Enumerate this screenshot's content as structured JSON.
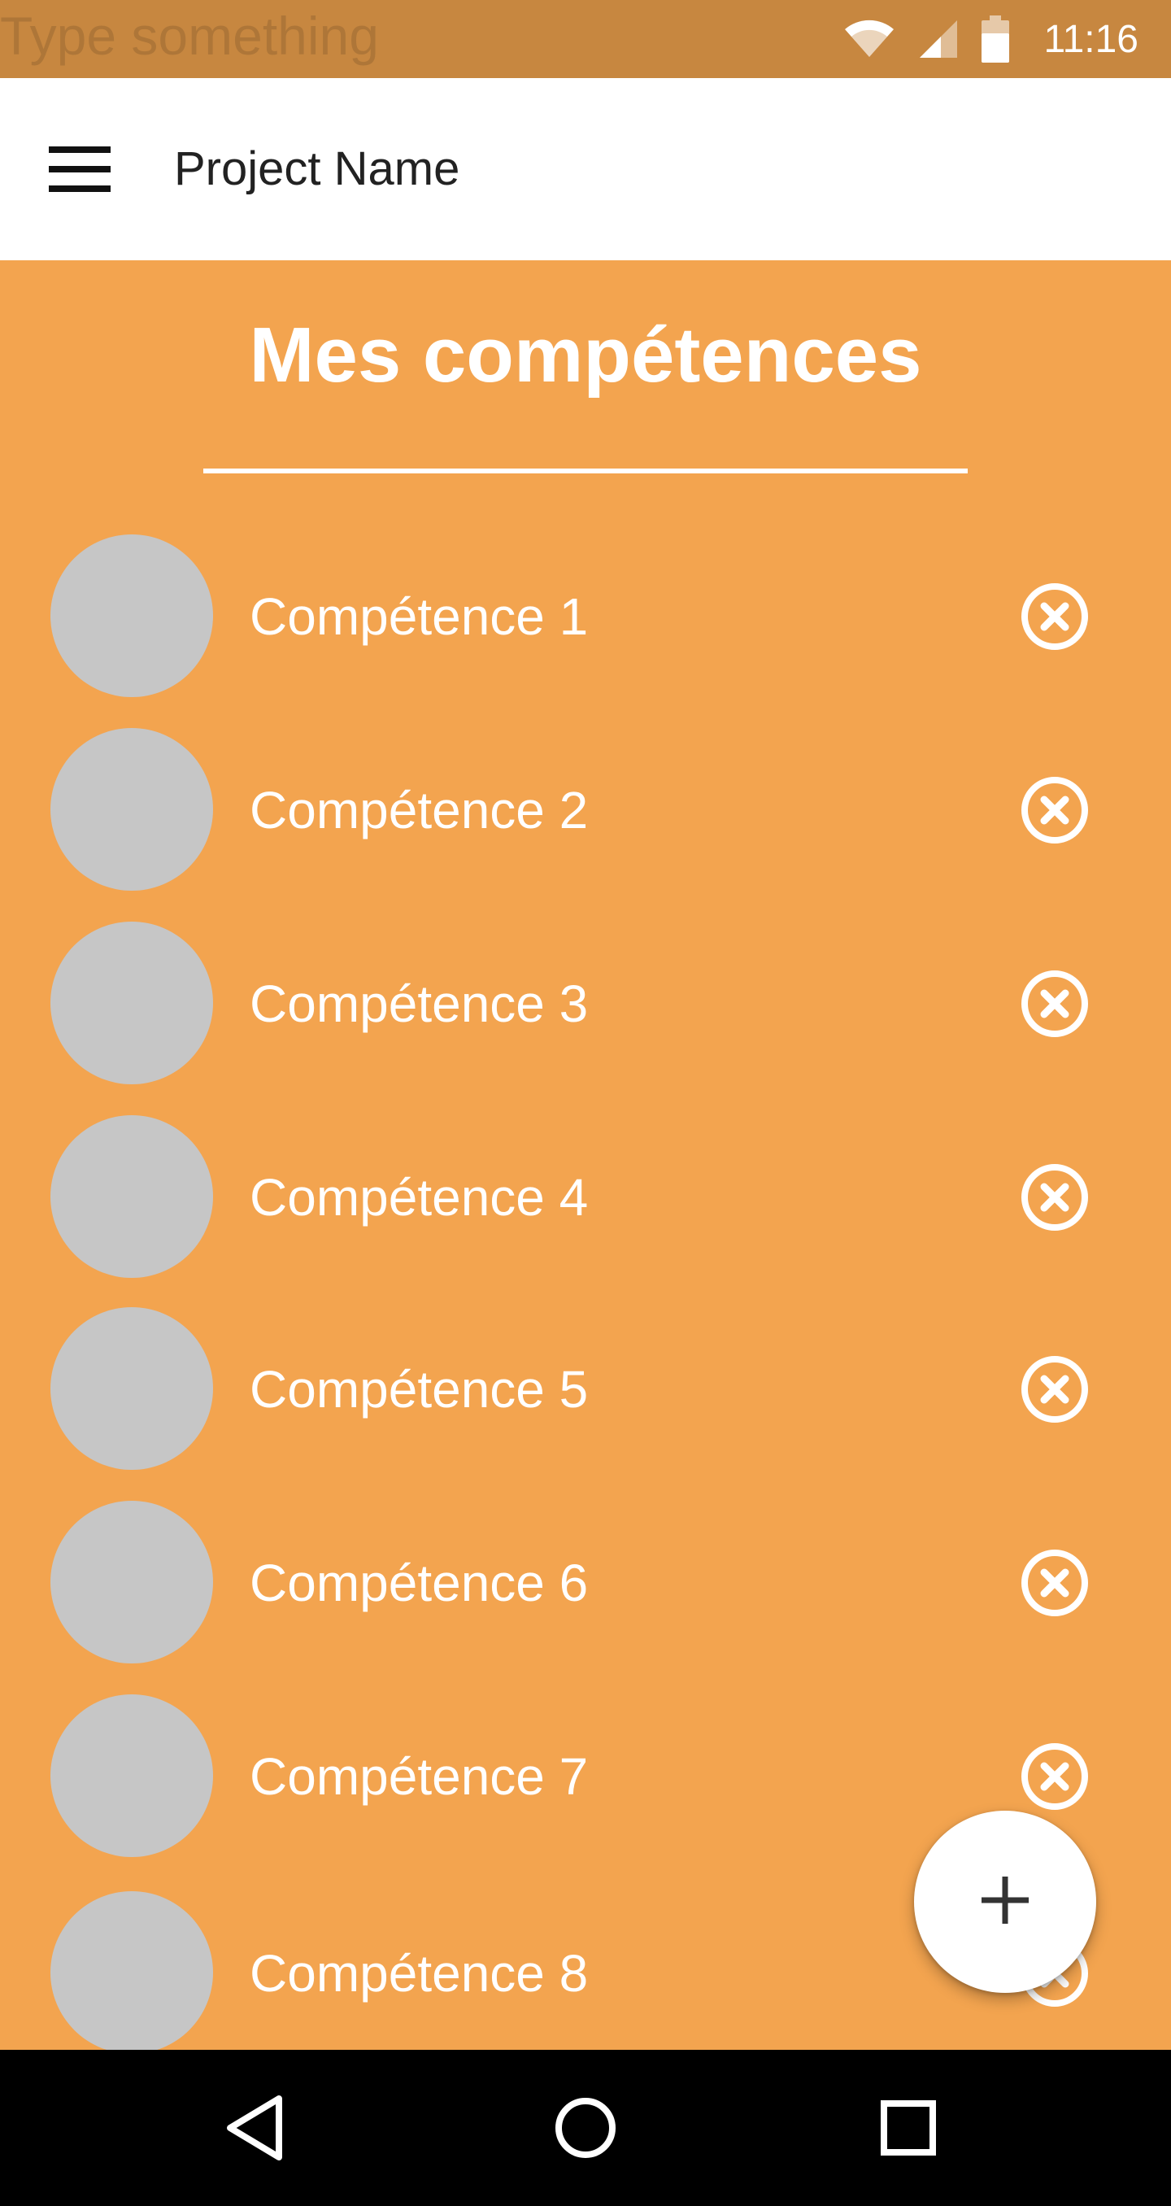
{
  "status_bar": {
    "hint_text": "Type something",
    "time": "11:16",
    "icons": [
      "wifi-icon",
      "signal-icon",
      "battery-icon"
    ]
  },
  "app_bar": {
    "menu_icon": "hamburger-menu-icon",
    "title": "Project Name"
  },
  "section": {
    "title": "Mes compétences"
  },
  "skills": [
    {
      "label": "Compétence 1",
      "action_icon": "remove-circle-icon"
    },
    {
      "label": "Compétence 2",
      "action_icon": "remove-circle-icon"
    },
    {
      "label": "Compétence 3",
      "action_icon": "remove-circle-icon"
    },
    {
      "label": "Compétence 4",
      "action_icon": "remove-circle-icon"
    },
    {
      "label": "Compétence 5",
      "action_icon": "remove-circle-icon"
    },
    {
      "label": "Compétence 6",
      "action_icon": "remove-circle-icon"
    },
    {
      "label": "Compétence 7",
      "action_icon": "remove-circle-icon"
    },
    {
      "label": "Compétence 8",
      "action_icon": "remove-circle-icon"
    }
  ],
  "fab": {
    "icon": "plus-icon"
  },
  "nav_bar": {
    "icons": [
      "back-icon",
      "home-icon",
      "recents-icon"
    ]
  },
  "colors": {
    "status_bar": "#c78740",
    "background": "#f3a44f",
    "avatar_placeholder": "#c6c6c6",
    "app_bar": "#ffffff",
    "nav_bar": "#000000"
  }
}
